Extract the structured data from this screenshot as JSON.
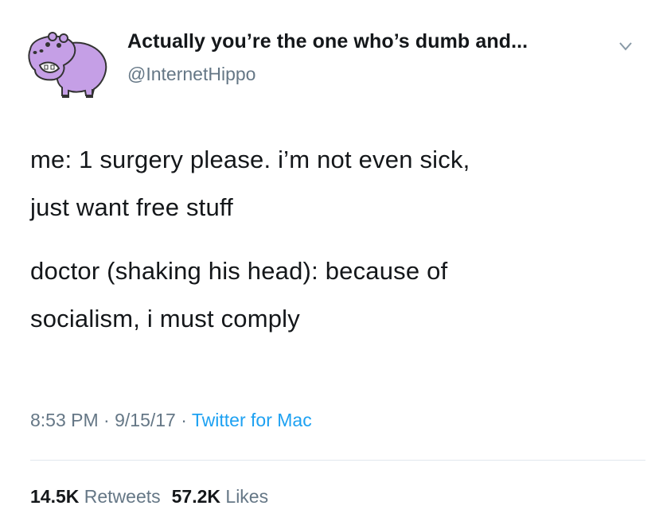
{
  "tweet": {
    "author": {
      "display_name": "Actually you’re the one who’s dumb and...",
      "handle": "@InternetHippo",
      "avatar_icon": "purple-hippo-avatar"
    },
    "menu_icon": "chevron-down-icon",
    "text_lines": [
      "me: 1 surgery please. i’m not even sick,",
      "just want free stuff",
      "doctor (shaking his head): because of",
      "socialism, i must comply"
    ],
    "timestamp": "8:53 PM",
    "date": "9/15/17",
    "separator": "·",
    "source": "Twitter for Mac",
    "stats": {
      "retweets_count": "14.5K",
      "retweets_label": "Retweets",
      "likes_count": "57.2K",
      "likes_label": "Likes"
    }
  },
  "colors": {
    "text": "#14171a",
    "secondary": "#657786",
    "link": "#1da1f2",
    "avatar_purple": "#c59fe6"
  }
}
